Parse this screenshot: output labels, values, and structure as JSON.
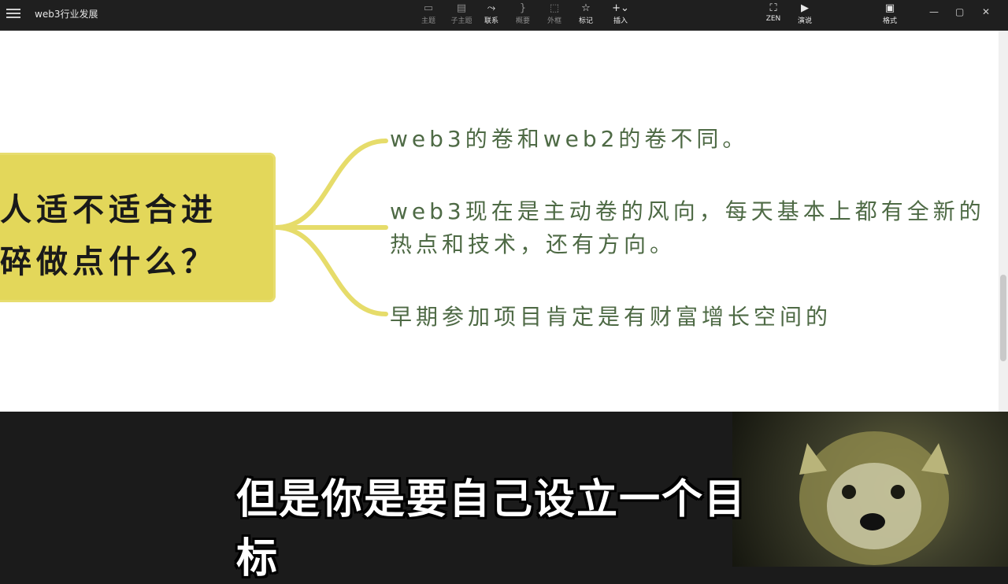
{
  "toolbar": {
    "doc_title": "web3行业发展",
    "tools": [
      {
        "label": "主题",
        "icon": "theme-icon"
      },
      {
        "label": "子主题",
        "icon": "subtopic-icon"
      },
      {
        "label": "联系",
        "icon": "relation-icon"
      },
      {
        "label": "概要",
        "icon": "summary-icon"
      },
      {
        "label": "外框",
        "icon": "boundary-icon"
      },
      {
        "label": "标记",
        "icon": "star-icon"
      },
      {
        "label": "插入",
        "icon": "plus-icon"
      },
      {
        "label": "ZEN",
        "icon": "zen-icon"
      },
      {
        "label": "演说",
        "icon": "pitch-icon"
      },
      {
        "label": "格式",
        "icon": "format-icon"
      }
    ]
  },
  "mindmap": {
    "root": {
      "line1": "人适不适合进",
      "line2": "碎做点什么？"
    },
    "branches": [
      {
        "text": "web3的卷和web2的卷不同。"
      },
      {
        "line1": "web3现在是主动卷的风向，每天基本上都有全新的",
        "line2": "热点和技术，还有方向。"
      },
      {
        "text": "早期参加项目肯定是有财富增长空间的"
      }
    ]
  },
  "subtitle": "但是你是要自己设立一个目标",
  "colors": {
    "root_fill": "#e3d75a",
    "branch_text": "#4e6a45",
    "link_line": "#e6dc6a"
  }
}
